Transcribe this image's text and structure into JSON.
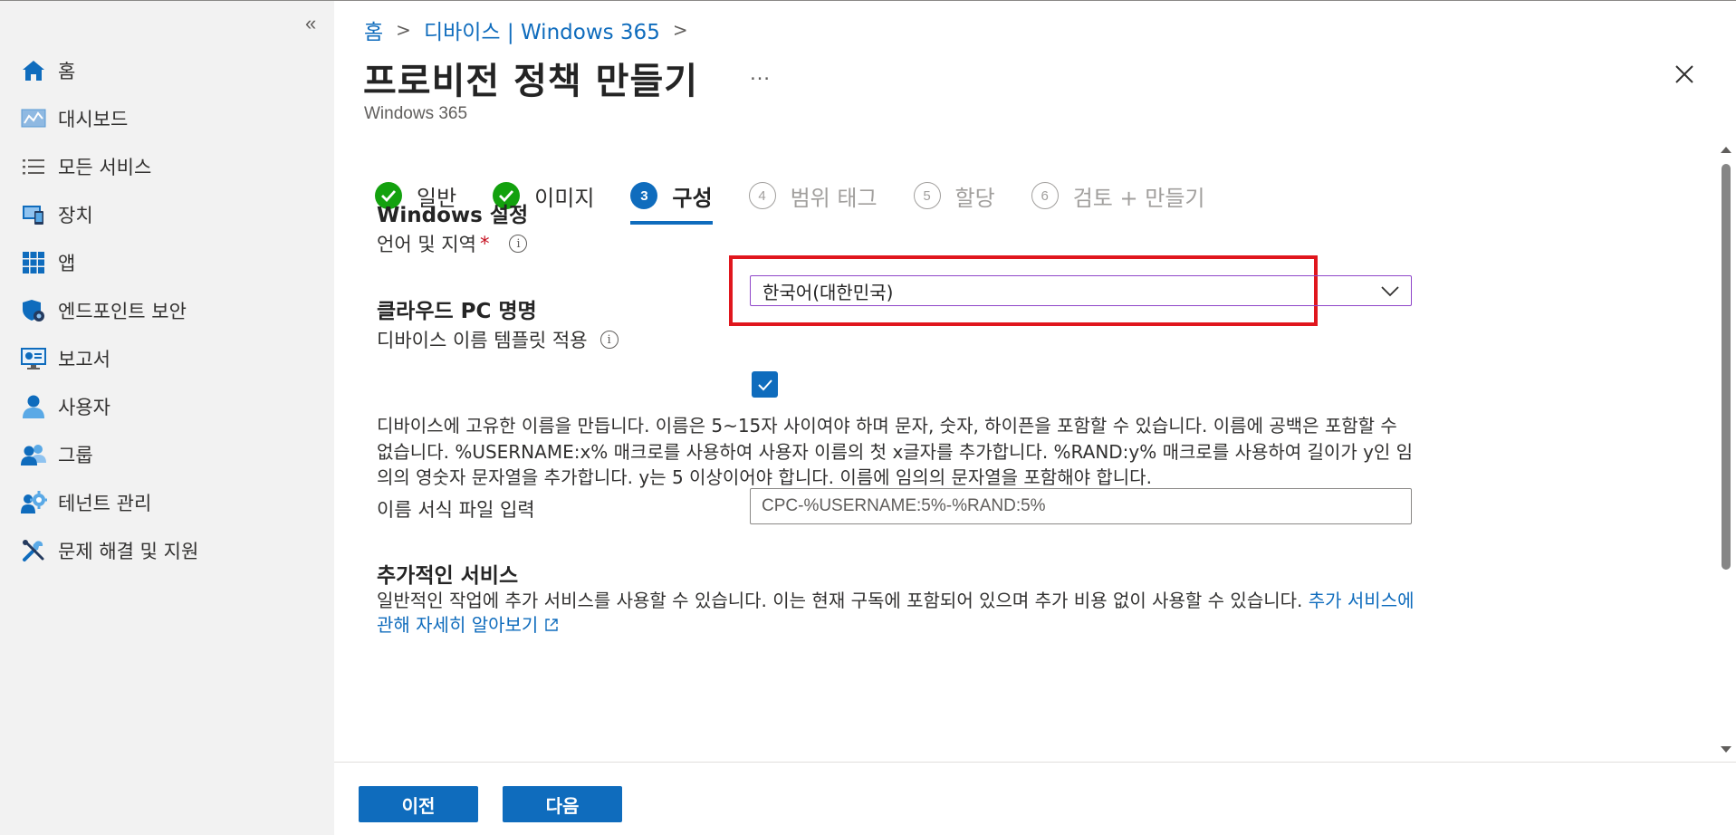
{
  "sidebar": {
    "collapse_label": "«",
    "items": [
      {
        "label": "홈",
        "icon": "home-icon"
      },
      {
        "label": "대시보드",
        "icon": "dashboard-icon"
      },
      {
        "label": "모든 서비스",
        "icon": "list-icon"
      },
      {
        "label": "장치",
        "icon": "devices-icon"
      },
      {
        "label": "앱",
        "icon": "apps-icon"
      },
      {
        "label": "엔드포인트 보안",
        "icon": "endpoint-security-icon"
      },
      {
        "label": "보고서",
        "icon": "reports-icon"
      },
      {
        "label": "사용자",
        "icon": "user-icon"
      },
      {
        "label": "그룹",
        "icon": "groups-icon"
      },
      {
        "label": "테넌트 관리",
        "icon": "tenant-admin-icon"
      },
      {
        "label": "문제 해결 및 지원",
        "icon": "troubleshooting-icon"
      }
    ]
  },
  "breadcrumb": {
    "home": "홈",
    "sep1": ">",
    "devices": "디바이스 | Windows 365",
    "sep2": ">"
  },
  "header": {
    "title": "프로비전 정책 만들기",
    "ellipsis": "…",
    "subtitle": "Windows 365"
  },
  "steps": [
    {
      "num": "",
      "label": "일반",
      "state": "done"
    },
    {
      "num": "",
      "label": "이미지",
      "state": "done"
    },
    {
      "num": "3",
      "label": "구성",
      "state": "current"
    },
    {
      "num": "4",
      "label": "범위 태그",
      "state": "todo"
    },
    {
      "num": "5",
      "label": "할당",
      "state": "todo"
    },
    {
      "num": "6",
      "label": "검토 + 만들기",
      "state": "todo"
    }
  ],
  "windows_settings": {
    "title": "Windows 설정",
    "language_label": "언어 및 지역",
    "required_mark": "*",
    "info": "i",
    "language_value": "한국어(대한민국)"
  },
  "cloud_pc_naming": {
    "title": "클라우드 PC 명명",
    "apply_template_label": "디바이스 이름 템플릿 적용",
    "info": "i",
    "apply_template_checked": true,
    "description": "디바이스에 고유한 이름을 만듭니다. 이름은 5~15자 사이여야 하며 문자, 숫자, 하이픈을 포함할 수 있습니다. 이름에 공백은 포함할 수 없습니다. %USERNAME:x% 매크로를 사용하여 사용자 이름의 첫 x글자를 추가합니다. %RAND:y% 매크로를 사용하여 길이가 y인 임의의 영숫자 문자열을 추가합니다. y는 5 이상이어야 합니다. 이름에 임의의 문자열을 포함해야 합니다.",
    "name_format_label": "이름 서식 파일 입력",
    "name_format_value": "CPC-%USERNAME:5%-%RAND:5%"
  },
  "additional_services": {
    "title": "추가적인 서비스",
    "description": "일반적인 작업에 추가 서비스를 사용할 수 있습니다. 이는 현재 구독에 포함되어 있으며 추가 비용 없이 사용할 수 있습니다.",
    "link": "추가 서비스에 관해 자세히 알아보기"
  },
  "footer": {
    "prev_label": "이전",
    "next_label": "다음"
  },
  "colors": {
    "accent": "#0f6cbd",
    "done": "#13a10e",
    "highlight": "#e0161d",
    "required": "#c50f1f"
  }
}
